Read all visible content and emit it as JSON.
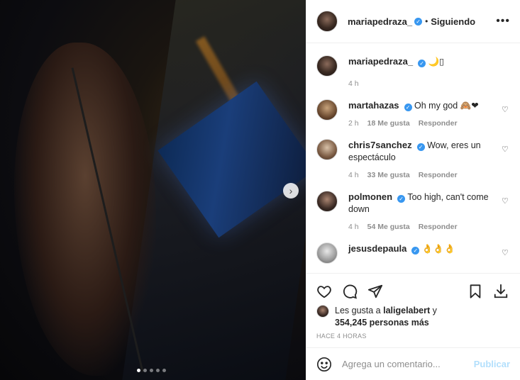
{
  "post": {
    "username": "mariapedraza_",
    "follow_separator": "•",
    "follow_label": "Siguiendo",
    "caption": "🌙▯",
    "caption_time": "4 h",
    "carousel_count": 5,
    "carousel_active_index": 0
  },
  "comments": [
    {
      "username": "martahazas",
      "verified": true,
      "text": "Oh my god 🙈❤",
      "time": "2 h",
      "likes": "18 Me gusta",
      "reply": "Responder"
    },
    {
      "username": "chris7sanchez",
      "verified": true,
      "text": "Wow, eres un espectáculo",
      "time": "4 h",
      "likes": "33 Me gusta",
      "reply": "Responder"
    },
    {
      "username": "polmonen",
      "verified": true,
      "text": "Too high, can't come down",
      "time": "4 h",
      "likes": "54 Me gusta",
      "reply": "Responder"
    },
    {
      "username": "jesusdepaula",
      "verified": true,
      "text": "👌👌👌",
      "time": "",
      "likes": "",
      "reply": ""
    }
  ],
  "likes": {
    "prefix": "Les gusta a",
    "first_user": "laligelabert",
    "connector": "y",
    "count_text": "354,245 personas más"
  },
  "timestamp": "HACE 4 HORAS",
  "add_comment": {
    "placeholder": "Agrega un comentario...",
    "post_label": "Publicar"
  },
  "icons": {
    "verified": "verified-badge-icon",
    "more": "more-options-icon",
    "heart": "heart-icon",
    "comment": "comment-icon",
    "share": "share-icon",
    "save": "bookmark-icon",
    "download": "download-icon",
    "emoji": "emoji-icon",
    "next": "chevron-right-icon"
  },
  "colors": {
    "verified": "#3897f0",
    "publish_disabled": "#b2dffc",
    "muted": "#8e8e8e"
  }
}
